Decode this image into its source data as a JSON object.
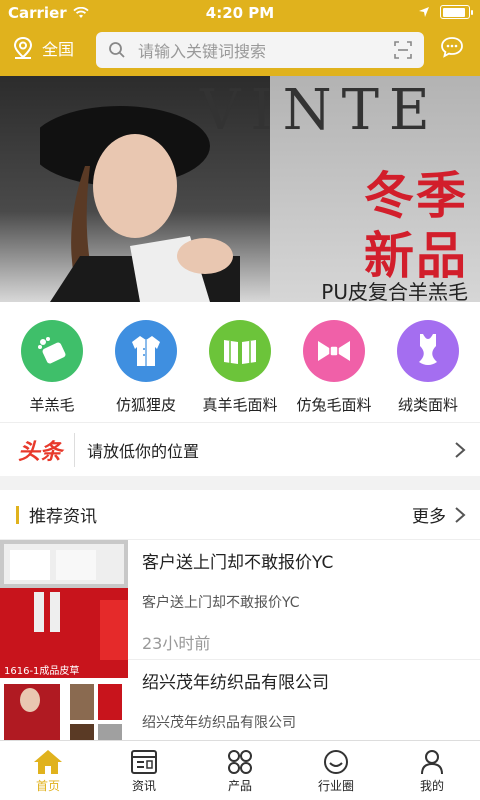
{
  "status": {
    "carrier": "Carrier",
    "time": "4:20 PM"
  },
  "header": {
    "location": "全国",
    "search_placeholder": "请输入关键词搜索"
  },
  "banner": {
    "brand": "VINTE",
    "title_line1": "冬季",
    "title_line2": "新品",
    "subtitle": "PU皮复合羊羔毛"
  },
  "categories": [
    {
      "label": "羊羔毛",
      "color": "#3fbf6a"
    },
    {
      "label": "仿狐狸皮",
      "color": "#3f8fe0"
    },
    {
      "label": "真羊毛面料",
      "color": "#6cc43a"
    },
    {
      "label": "仿兔毛面料",
      "color": "#f060a8"
    },
    {
      "label": "绒类面料",
      "color": "#a46ef0"
    }
  ],
  "headline": {
    "tag": "头条",
    "text": "请放低你的位置"
  },
  "recommend": {
    "title": "推荐资讯",
    "more": "更多",
    "items": [
      {
        "title": "客户送上门却不敢报价YC",
        "summary": "客户送上门却不敢报价YC",
        "time": "23小时前"
      },
      {
        "title": "绍兴茂年纺织品有限公司",
        "summary": "绍兴茂年纺织品有限公司",
        "thumb_caption": "1616-1成品皮草"
      }
    ]
  },
  "tabs": [
    {
      "label": "首页",
      "icon": "home-icon",
      "active": true
    },
    {
      "label": "资讯",
      "icon": "news-icon"
    },
    {
      "label": "产品",
      "icon": "products-icon"
    },
    {
      "label": "行业圈",
      "icon": "smile-icon"
    },
    {
      "label": "我的",
      "icon": "user-icon"
    }
  ],
  "colors": {
    "accent": "#e0b21d",
    "headline_red": "#e8392b"
  }
}
